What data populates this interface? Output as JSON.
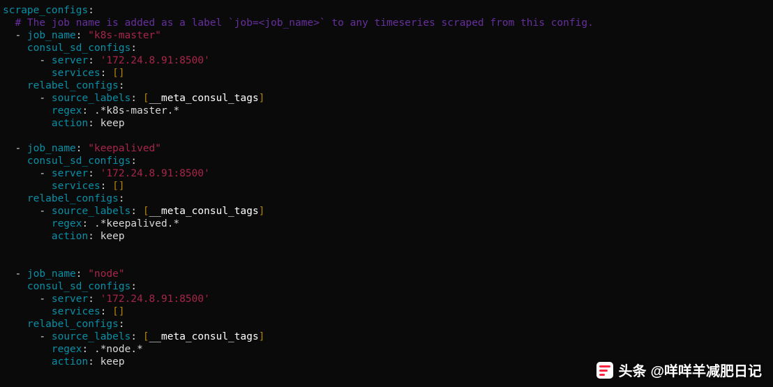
{
  "config": {
    "top_key": "scrape_configs",
    "comment": "# The job name is added as a label `job=<job_name>` to any timeseries scraped from this config.",
    "jobs": [
      {
        "job_name": "\"k8s-master\"",
        "server": "'172.24.8.91:8500'",
        "services": "[]",
        "source_labels_open": "[",
        "source_label_val": "__meta_consul_tags",
        "source_labels_close": "]",
        "regex": ".*k8s-master.*",
        "action": "keep"
      },
      {
        "job_name": "\"keepalived\"",
        "server": "'172.24.8.91:8500'",
        "services": "[]",
        "source_labels_open": "[",
        "source_label_val": "__meta_consul_tags",
        "source_labels_close": "]",
        "regex": ".*keepalived.*",
        "action": "keep"
      },
      {
        "job_name": "\"node\"",
        "server": "'172.24.8.91:8500'",
        "services": "[]",
        "source_labels_open": "[",
        "source_label_val": "__meta_consul_tags",
        "source_labels_close": "]",
        "regex": ".*node.*",
        "action": "keep"
      }
    ],
    "labels": {
      "job_name": "job_name",
      "consul_sd_configs": "consul_sd_configs",
      "server": "server",
      "services": "services",
      "relabel_configs": "relabel_configs",
      "source_labels": "source_labels",
      "regex": "regex",
      "action": "action"
    }
  },
  "watermark": {
    "brand": "头条",
    "handle": "@咩咩羊减肥日记"
  }
}
